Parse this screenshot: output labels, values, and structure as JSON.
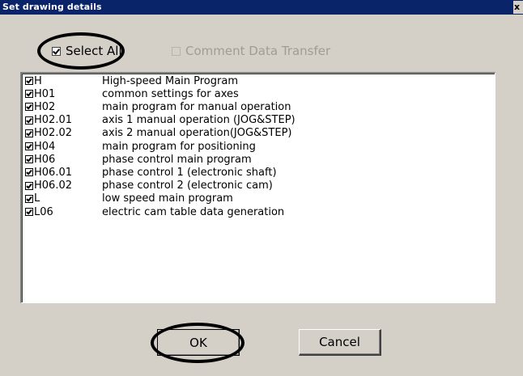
{
  "window": {
    "title": "Set drawing details",
    "close_glyph": "x"
  },
  "options": {
    "select_all_label": "Select All",
    "select_all_checked": true,
    "comment_transfer_label": "Comment Data Transfer",
    "comment_transfer_enabled": false
  },
  "list": {
    "items": [
      {
        "code": "H",
        "desc": "High-speed Main Program",
        "checked": true
      },
      {
        "code": "H01",
        "desc": "common settings for axes",
        "checked": true
      },
      {
        "code": "H02",
        "desc": "main program for manual operation",
        "checked": true
      },
      {
        "code": "H02.01",
        "desc": "axis 1 manual operation (JOG&STEP)",
        "checked": true
      },
      {
        "code": "H02.02",
        "desc": "axis 2 manual operation(JOG&STEP)",
        "checked": true
      },
      {
        "code": "H04",
        "desc": "main program for positioning",
        "checked": true
      },
      {
        "code": "H06",
        "desc": "phase control main program",
        "checked": true
      },
      {
        "code": "H06.01",
        "desc": "phase control 1 (electronic shaft)",
        "checked": true
      },
      {
        "code": "H06.02",
        "desc": "phase control 2 (electronic cam)",
        "checked": true
      },
      {
        "code": "L",
        "desc": "low speed main program",
        "checked": true
      },
      {
        "code": "L06",
        "desc": "electric cam table data generation",
        "checked": true
      }
    ]
  },
  "buttons": {
    "ok_label": "OK",
    "cancel_label": "Cancel"
  }
}
